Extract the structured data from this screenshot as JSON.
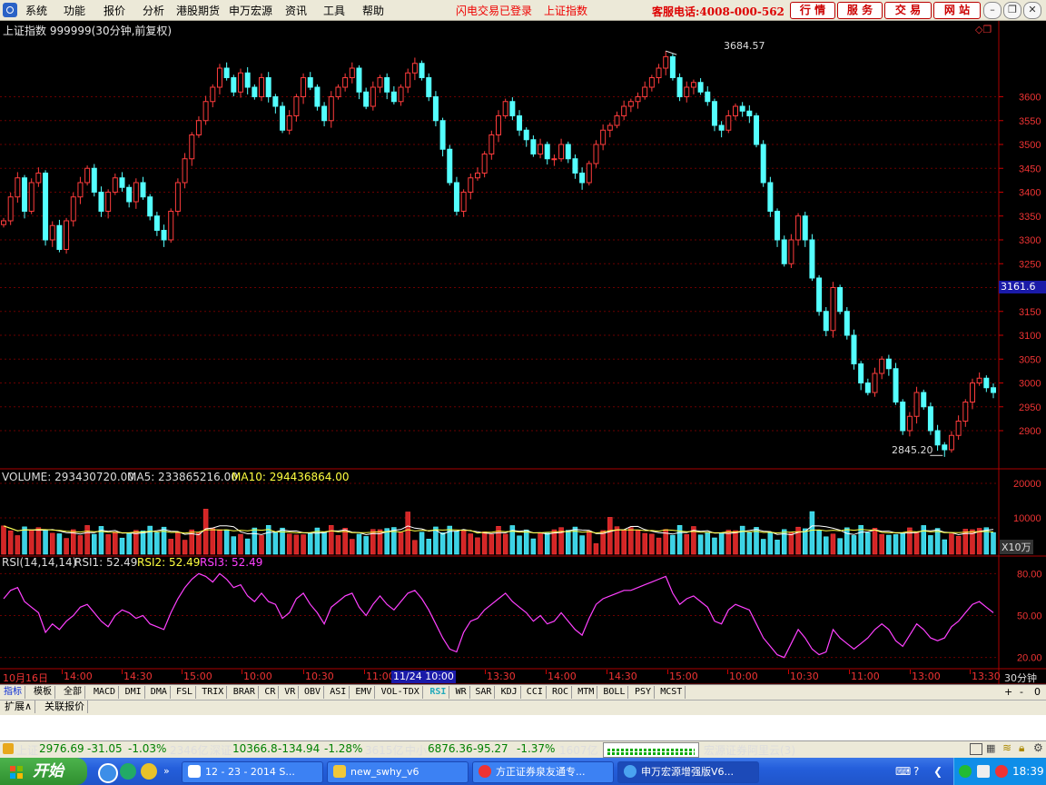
{
  "menu": {
    "items": [
      "系统",
      "功能",
      "报价",
      "分析",
      "港股期货",
      "申万宏源",
      "资讯",
      "工具",
      "帮助"
    ],
    "links": [
      "闪电交易已登录",
      "上证指数"
    ],
    "hotline": "客服电话:4008-000-562",
    "buttons": [
      "行 情",
      "服 务",
      "交 易",
      "网 站"
    ]
  },
  "chart_header": {
    "title": "上证指数 999999(30分钟,前复权)",
    "high_label": "3684.57",
    "low_label": "2845.20",
    "last_price": "3161.6"
  },
  "volume_panel": {
    "label": "VOLUME: 293430720.00",
    "ma5": "MA5: 233865216.00",
    "ma10": "MA10: 294436864.00",
    "unit": "X10万"
  },
  "rsi_panel": {
    "label": "RSI(14,14,14)",
    "rsi1": "RSI1: 52.49",
    "rsi2": "RSI2: 52.49",
    "rsi3": "RSI3: 52.49"
  },
  "time_axis": {
    "labels": [
      "10月16日",
      "14:00",
      "14:30",
      "15:00",
      "10:00",
      "10:30",
      "11:00",
      "13:00",
      "13:30",
      "14:00",
      "14:30",
      "15:00",
      "10:00",
      "10:30",
      "11:00",
      "13:00",
      "13:30"
    ],
    "cursor_label": "11/24 10:00",
    "period": "30分钟"
  },
  "indicator_tabs": [
    "指标",
    "模板",
    "全部",
    "MACD",
    "DMI",
    "DMA",
    "FSL",
    "TRIX",
    "BRAR",
    "CR",
    "VR",
    "OBV",
    "ASI",
    "EMV",
    "VOL-TDX",
    "RSI",
    "WR",
    "SAR",
    "KDJ",
    "CCI",
    "ROC",
    "MTM",
    "BOLL",
    "PSY",
    "MCST"
  ],
  "indicator_controls": [
    "+",
    "-",
    "0"
  ],
  "expand_tabs": [
    "扩展∧",
    "关联报价"
  ],
  "quote_bar": {
    "sh_name": "上证",
    "sh_price": "2976.69",
    "sh_change": "-31.05",
    "sh_pct": "-1.03%",
    "sh_amount": "2346亿",
    "sz_name": "深证",
    "sz_price": "10366.8",
    "sz_change": "-134.94",
    "sz_pct": "-1.28%",
    "sz_amount": "3615亿",
    "sme_name": "中小",
    "sme_price": "6876.36",
    "sme_change": "-95.27",
    "sme_pct": "-1.37%",
    "sme_amount": "1607亿",
    "server": "宏源证券阿里云(3)"
  },
  "taskbar": {
    "start": "开始",
    "tasks": [
      "12 - 23 - 2014 S...",
      "new_swhy_v6",
      "方正证券泉友通专...",
      "申万宏源增强版V6..."
    ],
    "clock": "18:39"
  },
  "chart_data": [
    {
      "type": "candlestick",
      "title": "上证指数 999999(30分钟,前复权)",
      "y_ticks": [
        2900,
        2950,
        3000,
        3050,
        3100,
        3150,
        3200,
        3250,
        3300,
        3350,
        3400,
        3450,
        3500,
        3550,
        3600
      ],
      "ylim": [
        2820,
        3740
      ],
      "close_path": [
        3340,
        3390,
        3430,
        3360,
        3420,
        3440,
        3300,
        3330,
        3280,
        3340,
        3390,
        3420,
        3450,
        3400,
        3360,
        3400,
        3430,
        3410,
        3380,
        3420,
        3390,
        3350,
        3320,
        3300,
        3360,
        3420,
        3470,
        3520,
        3550,
        3590,
        3620,
        3660,
        3640,
        3610,
        3650,
        3620,
        3600,
        3640,
        3600,
        3580,
        3530,
        3560,
        3600,
        3640,
        3620,
        3580,
        3550,
        3600,
        3620,
        3640,
        3660,
        3610,
        3580,
        3620,
        3640,
        3610,
        3590,
        3620,
        3650,
        3670,
        3640,
        3600,
        3550,
        3490,
        3420,
        3360,
        3400,
        3430,
        3440,
        3480,
        3520,
        3560,
        3590,
        3560,
        3530,
        3510,
        3480,
        3500,
        3470,
        3470,
        3500,
        3470,
        3440,
        3420,
        3460,
        3500,
        3530,
        3540,
        3560,
        3580,
        3590,
        3600,
        3620,
        3640,
        3660,
        3684,
        3640,
        3600,
        3620,
        3630,
        3610,
        3590,
        3540,
        3530,
        3560,
        3580,
        3570,
        3560,
        3500,
        3420,
        3360,
        3300,
        3250,
        3300,
        3350,
        3300,
        3220,
        3150,
        3110,
        3200,
        3150,
        3100,
        3040,
        3000,
        2980,
        3020,
        3050,
        3030,
        2960,
        2900,
        2930,
        2980,
        2950,
        2900,
        2870,
        2860,
        2890,
        2920,
        2960,
        3000,
        3010,
        2990,
        2980
      ]
    },
    {
      "type": "bar",
      "title": "VOLUME",
      "y_ticks": [
        10000,
        20000
      ],
      "unit": "X10万"
    },
    {
      "type": "line",
      "title": "RSI(14,14,14)",
      "y_ticks": [
        20,
        50,
        80
      ],
      "ylim": [
        12,
        88
      ],
      "series": [
        {
          "name": "RSI1",
          "values": [
            62,
            68,
            70,
            60,
            56,
            52,
            38,
            44,
            40,
            46,
            50,
            56,
            58,
            52,
            46,
            42,
            50,
            54,
            52,
            48,
            50,
            44,
            42,
            40,
            52,
            62,
            70,
            76,
            80,
            78,
            74,
            80,
            76,
            70,
            72,
            64,
            60,
            66,
            60,
            58,
            48,
            52,
            62,
            66,
            58,
            52,
            44,
            56,
            60,
            64,
            66,
            56,
            50,
            58,
            64,
            58,
            54,
            60,
            66,
            68,
            62,
            54,
            44,
            34,
            26,
            24,
            38,
            46,
            48,
            54,
            58,
            62,
            66,
            60,
            56,
            52,
            46,
            50,
            44,
            46,
            52,
            46,
            40,
            36,
            48,
            58,
            62,
            64,
            66,
            68,
            68,
            70,
            72,
            74,
            76,
            78,
            66,
            58,
            62,
            64,
            60,
            56,
            46,
            44,
            54,
            58,
            56,
            54,
            44,
            34,
            28,
            22,
            20,
            30,
            40,
            34,
            26,
            22,
            24,
            40,
            34,
            30,
            26,
            30,
            34,
            40,
            44,
            40,
            32,
            28,
            36,
            44,
            40,
            34,
            32,
            34,
            42,
            46,
            52,
            58,
            60,
            56,
            52
          ]
        }
      ]
    }
  ]
}
